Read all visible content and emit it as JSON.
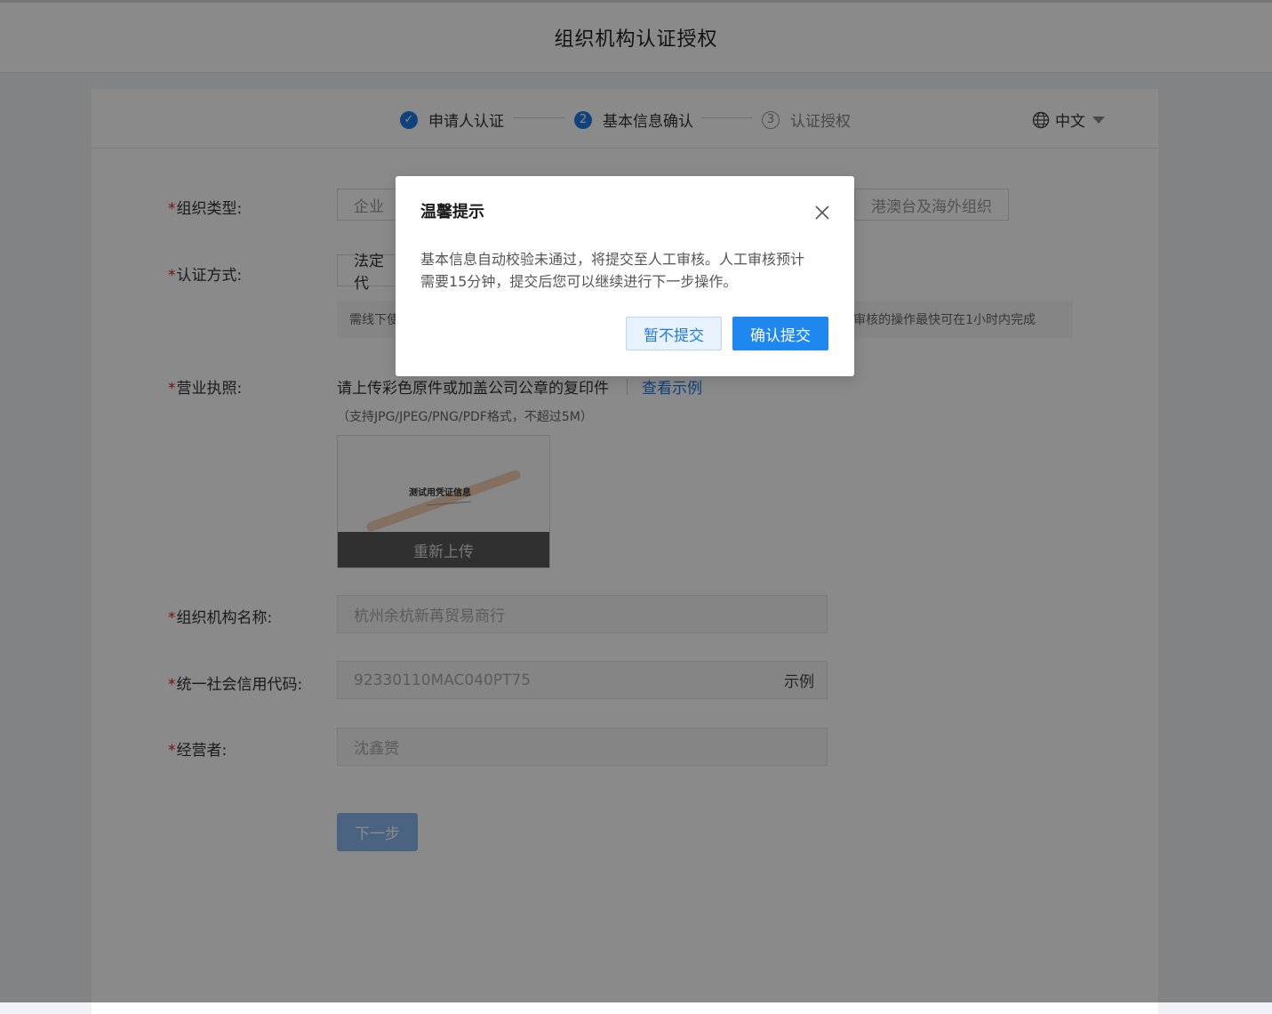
{
  "header": {
    "title": "组织机构认证授权"
  },
  "steps": [
    {
      "num": "✓",
      "label": "申请人认证",
      "state": "done"
    },
    {
      "num": "2",
      "label": "基本信息确认",
      "state": "active"
    },
    {
      "num": "3",
      "label": "认证授权",
      "state": "todo"
    }
  ],
  "language": {
    "label": "中文",
    "icon": "globe-icon"
  },
  "form": {
    "required_mark": "*",
    "org_type": {
      "label": "组织类型:",
      "options": [
        "企业",
        "港澳台及海外组织"
      ]
    },
    "auth_method": {
      "label": "认证方式:",
      "selected": "法定代",
      "hint_start": "需线下使",
      "hint_end": "审核的操作最快可在1小时内完成"
    },
    "license": {
      "label": "营业执照:",
      "instruction": "请上传彩色原件或加盖公司公章的复印件",
      "example_link": "查看示例",
      "formats": "（支持JPG/JPEG/PNG/PDF格式，不超过5M）",
      "thumbnail_text": "测试用凭证信息",
      "reupload": "重新上传"
    },
    "org_name": {
      "label": "组织机构名称:",
      "value": "杭州余杭新苒贸易商行"
    },
    "credit_code": {
      "label": "统一社会信用代码:",
      "value": "92330110MAC040PT75",
      "suffix": "示例"
    },
    "operator": {
      "label": "经营者:",
      "value": "沈鑫赟"
    },
    "next_button": "下一步"
  },
  "modal": {
    "title": "温馨提示",
    "body_line1": "基本信息自动校验未通过，将提交至人工审核。人工审核预计",
    "body_line2": "需要15分钟，提交后您可以继续进行下一步操作。",
    "cancel_button": "暂不提交",
    "confirm_button": "确认提交"
  },
  "colors": {
    "accent": "#1e7ae6",
    "required": "#e02020",
    "overlay": "rgba(0,0,0,0.46)"
  }
}
